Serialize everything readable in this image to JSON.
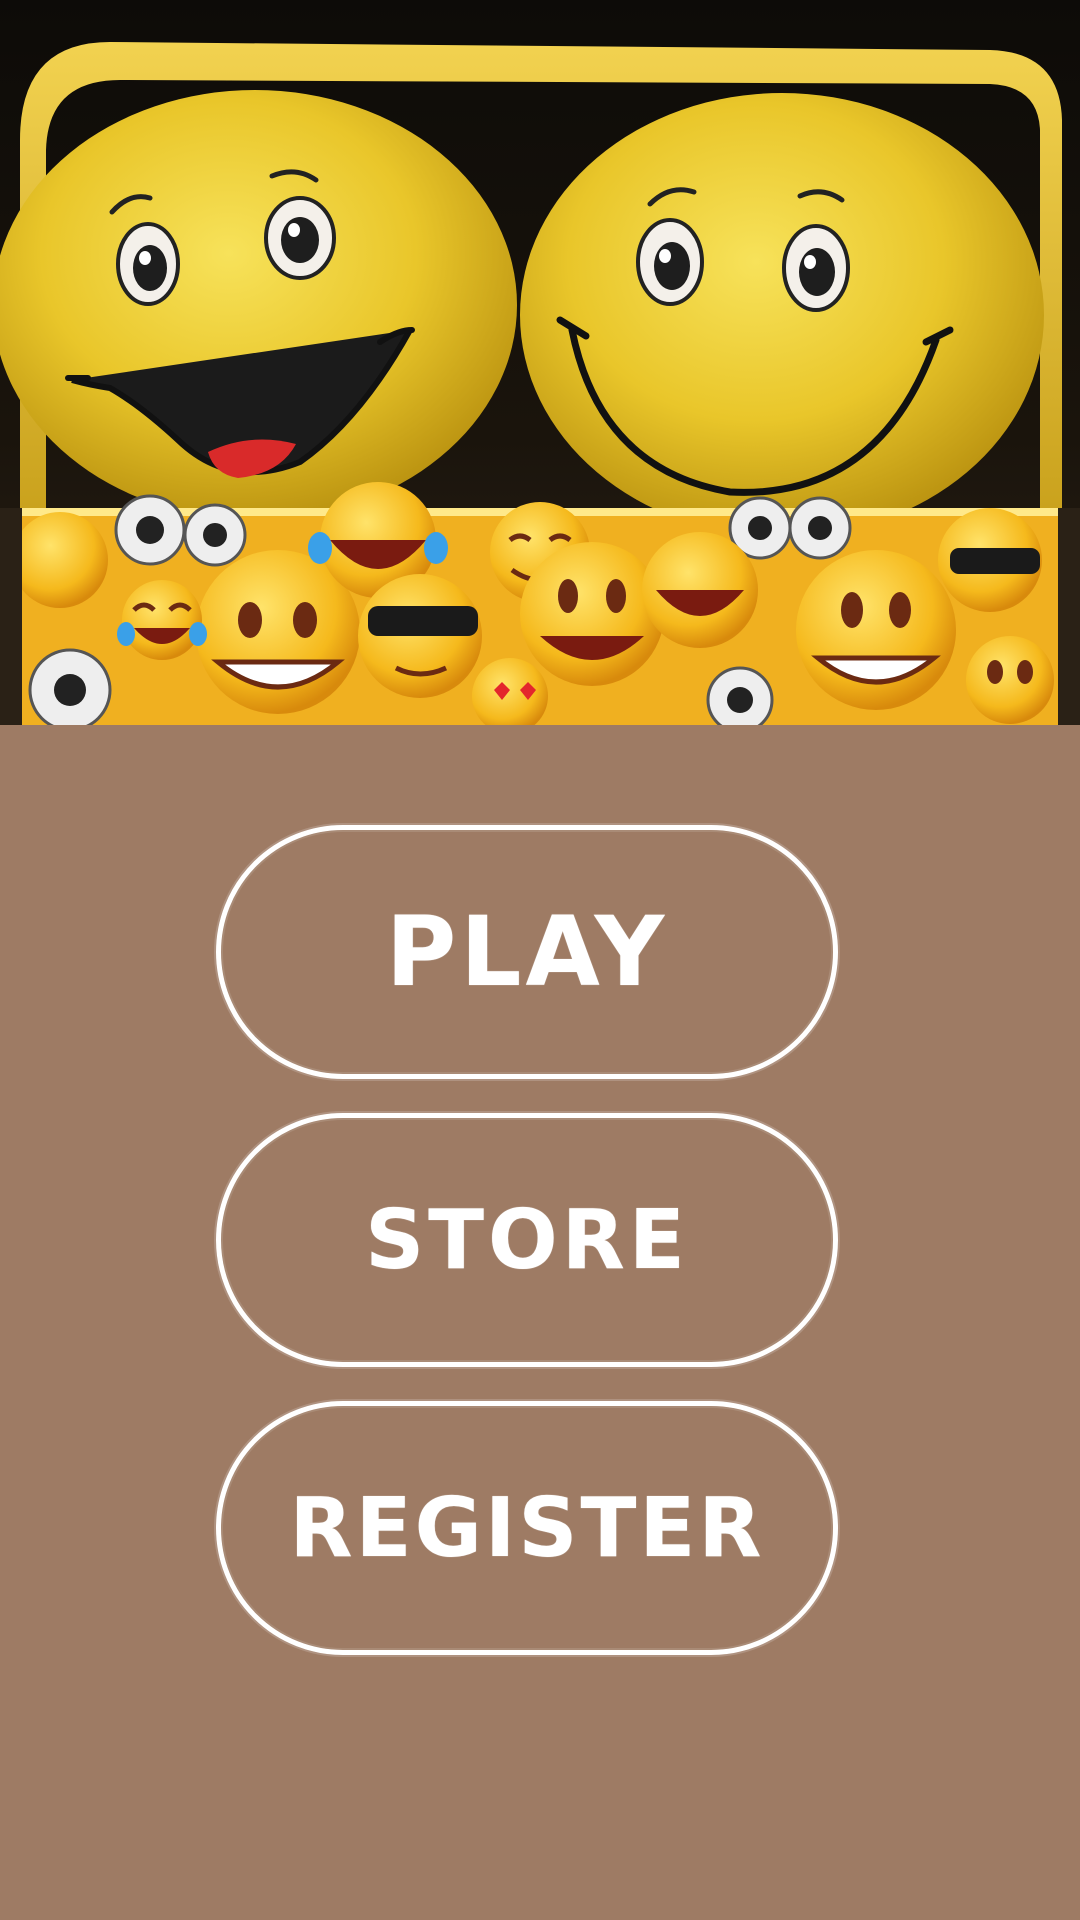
{
  "hero": {
    "image": "smiley-plush-toys-on-emoji-box"
  },
  "menu": {
    "play_label": "PLAY",
    "store_label": "STORE",
    "register_label": "REGISTER"
  },
  "colors": {
    "background": "#9e7b64",
    "button_border": "#ffffff",
    "button_text": "#ffffff"
  }
}
